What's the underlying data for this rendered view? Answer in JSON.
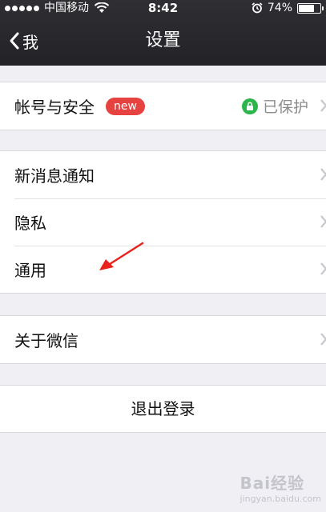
{
  "status_bar": {
    "carrier": "中国移动",
    "time": "8:42",
    "battery": "74%",
    "battery_level": 0.74
  },
  "nav": {
    "back_label": "我",
    "title": "设置"
  },
  "account": {
    "label": "帐号与安全",
    "badge": "new",
    "status": "已保护"
  },
  "settings_items": [
    {
      "label": "新消息通知"
    },
    {
      "label": "隐私"
    },
    {
      "label": "通用"
    }
  ],
  "about": {
    "label": "关于微信"
  },
  "logout": {
    "label": "退出登录"
  },
  "watermark": {
    "text": "Bai经验",
    "sub": "jingyan.baidu.com"
  },
  "colors": {
    "nav_bg": "#2a2a2e",
    "badge": "#e64340",
    "lock": "#2bb54a",
    "annotation_arrow": "#e8231e"
  }
}
